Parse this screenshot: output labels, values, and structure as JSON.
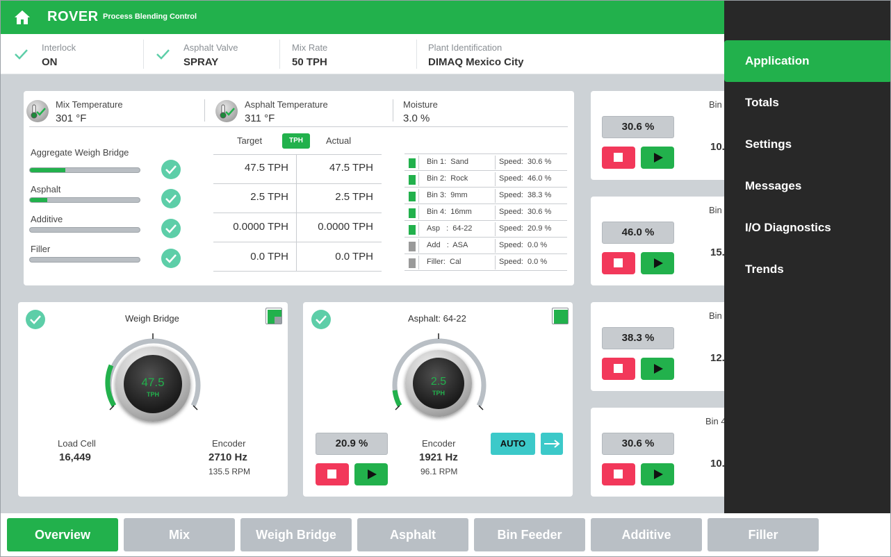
{
  "header": {
    "title": "ROVER",
    "subtitle": "Process Blending Control"
  },
  "status": [
    {
      "label": "Interlock",
      "value": "ON"
    },
    {
      "label": "Asphalt Valve",
      "value": "SPRAY"
    },
    {
      "label": "Mix Rate",
      "value": "50 TPH"
    },
    {
      "label": "Plant Identification",
      "value": "DIMAQ Mexico City"
    }
  ],
  "overview": {
    "mix_temp": {
      "label": "Mix Temperature",
      "value": "301 °F"
    },
    "asphalt_temp": {
      "label": "Asphalt Temperature",
      "value": "311 °F"
    },
    "moisture": {
      "label": "Moisture",
      "value": "3.0 %"
    },
    "table_headers": {
      "target": "Target",
      "unit": "TPH",
      "actual": "Actual"
    },
    "materials": [
      {
        "label": "Aggregate Weigh Bridge",
        "progress": 0.32,
        "target": "47.5 TPH",
        "actual": "47.5 TPH"
      },
      {
        "label": "Asphalt",
        "progress": 0.16,
        "target": "2.5 TPH",
        "actual": "2.5 TPH"
      },
      {
        "label": "Additive",
        "progress": 0,
        "target": "0.0000 TPH",
        "actual": "0.0000 TPH"
      },
      {
        "label": "Filler",
        "progress": 0,
        "target": "0.0 TPH",
        "actual": "0.0 TPH"
      }
    ],
    "bins": [
      {
        "name": "Bin 1:  Sand",
        "speed": "Speed:  30.6 %",
        "color": "#22b14c"
      },
      {
        "name": "Bin 2:  Rock",
        "speed": "Speed:  46.0 %",
        "color": "#22b14c"
      },
      {
        "name": "Bin 3:  9mm",
        "speed": "Speed:  38.3 %",
        "color": "#22b14c"
      },
      {
        "name": "Bin 4:  16mm",
        "speed": "Speed:  30.6 %",
        "color": "#22b14c"
      },
      {
        "name": "Asp   :  64-22",
        "speed": "Speed:  20.9 %",
        "color": "#22b14c"
      },
      {
        "name": "Add   :  ASA",
        "speed": "Speed:  0.0 %",
        "color": "#9a9a9a"
      },
      {
        "name": "Filler:  Cal",
        "speed": "Speed:  0.0 %",
        "color": "#9a9a9a"
      }
    ]
  },
  "weigh_bridge": {
    "title": "Weigh Bridge",
    "gauge_value": "47.5",
    "gauge_unit": "TPH",
    "load_cell_label": "Load Cell",
    "load_cell_value": "16,449",
    "encoder_label": "Encoder",
    "encoder_hz": "2710 Hz",
    "encoder_rpm": "135.5 RPM"
  },
  "asphalt_panel": {
    "title": "Asphalt: 64-22",
    "gauge_value": "2.5",
    "gauge_unit": "TPH",
    "speed_pct": "20.9 %",
    "encoder_label": "Encoder",
    "encoder_hz": "1921 Hz",
    "encoder_rpm": "96.1 RPM",
    "auto_label": "AUTO"
  },
  "bin_cards": [
    {
      "title": "Bin",
      "pct": "30.6 %",
      "num": "10."
    },
    {
      "title": "Bin",
      "pct": "46.0 %",
      "num": "15."
    },
    {
      "title": "Bin",
      "pct": "38.3 %",
      "num": "12."
    },
    {
      "title": "Bin 4",
      "pct": "30.6 %",
      "num": "10."
    }
  ],
  "tabs": [
    "Overview",
    "Mix",
    "Weigh Bridge",
    "Asphalt",
    "Bin Feeder",
    "Additive",
    "Filler"
  ],
  "menu": [
    "Application",
    "Totals",
    "Settings",
    "Messages",
    "I/O Diagnostics",
    "Trends"
  ],
  "colors": {
    "brand_green": "#22b14c",
    "stop_red": "#f2385a",
    "teal": "#3cc9c9",
    "menu_bg": "#282828"
  }
}
